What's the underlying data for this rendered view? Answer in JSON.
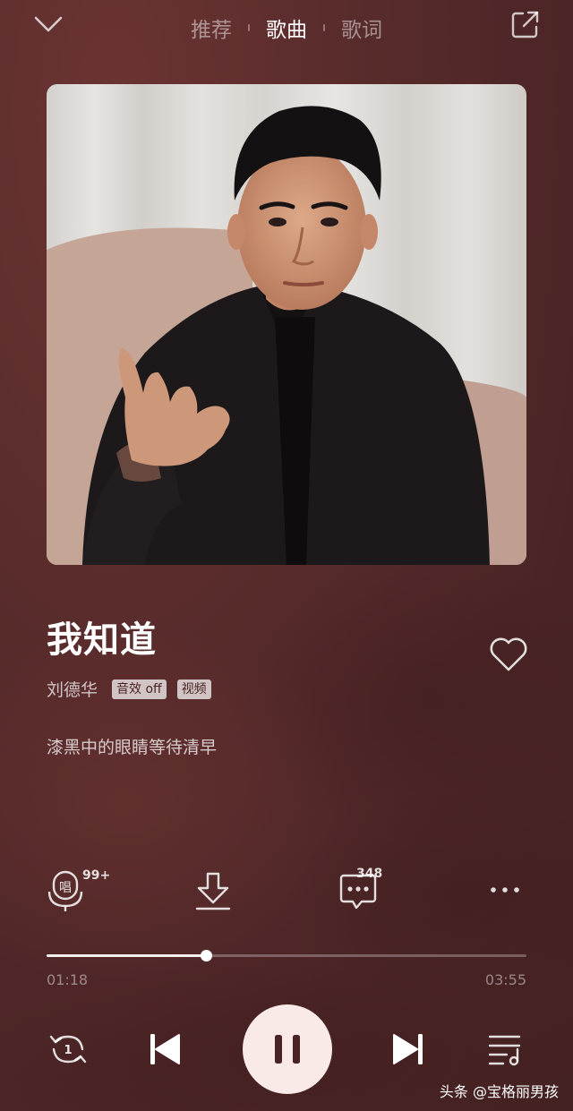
{
  "header": {
    "tabs": [
      {
        "label": "推荐",
        "active": false
      },
      {
        "label": "歌曲",
        "active": true
      },
      {
        "label": "歌词",
        "active": false
      }
    ],
    "collapse_icon": "chevron-down-icon",
    "share_icon": "share-out-icon"
  },
  "song": {
    "title": "我知道",
    "artist": "刘德华",
    "badges": [
      "音效 off",
      "视频"
    ],
    "lyric_line": "漆黑中的眼睛等待清早",
    "liked": false
  },
  "actions": {
    "sing_count": "99+",
    "comment_count": "348"
  },
  "playback": {
    "current_time": "01:18",
    "total_time": "03:55",
    "progress": 0.332,
    "state": "playing"
  },
  "watermark": "头条 @宝格丽男孩",
  "colors": {
    "background": "#552a2a",
    "play_button": "#f9e9e7",
    "accent": "#ffffff"
  }
}
